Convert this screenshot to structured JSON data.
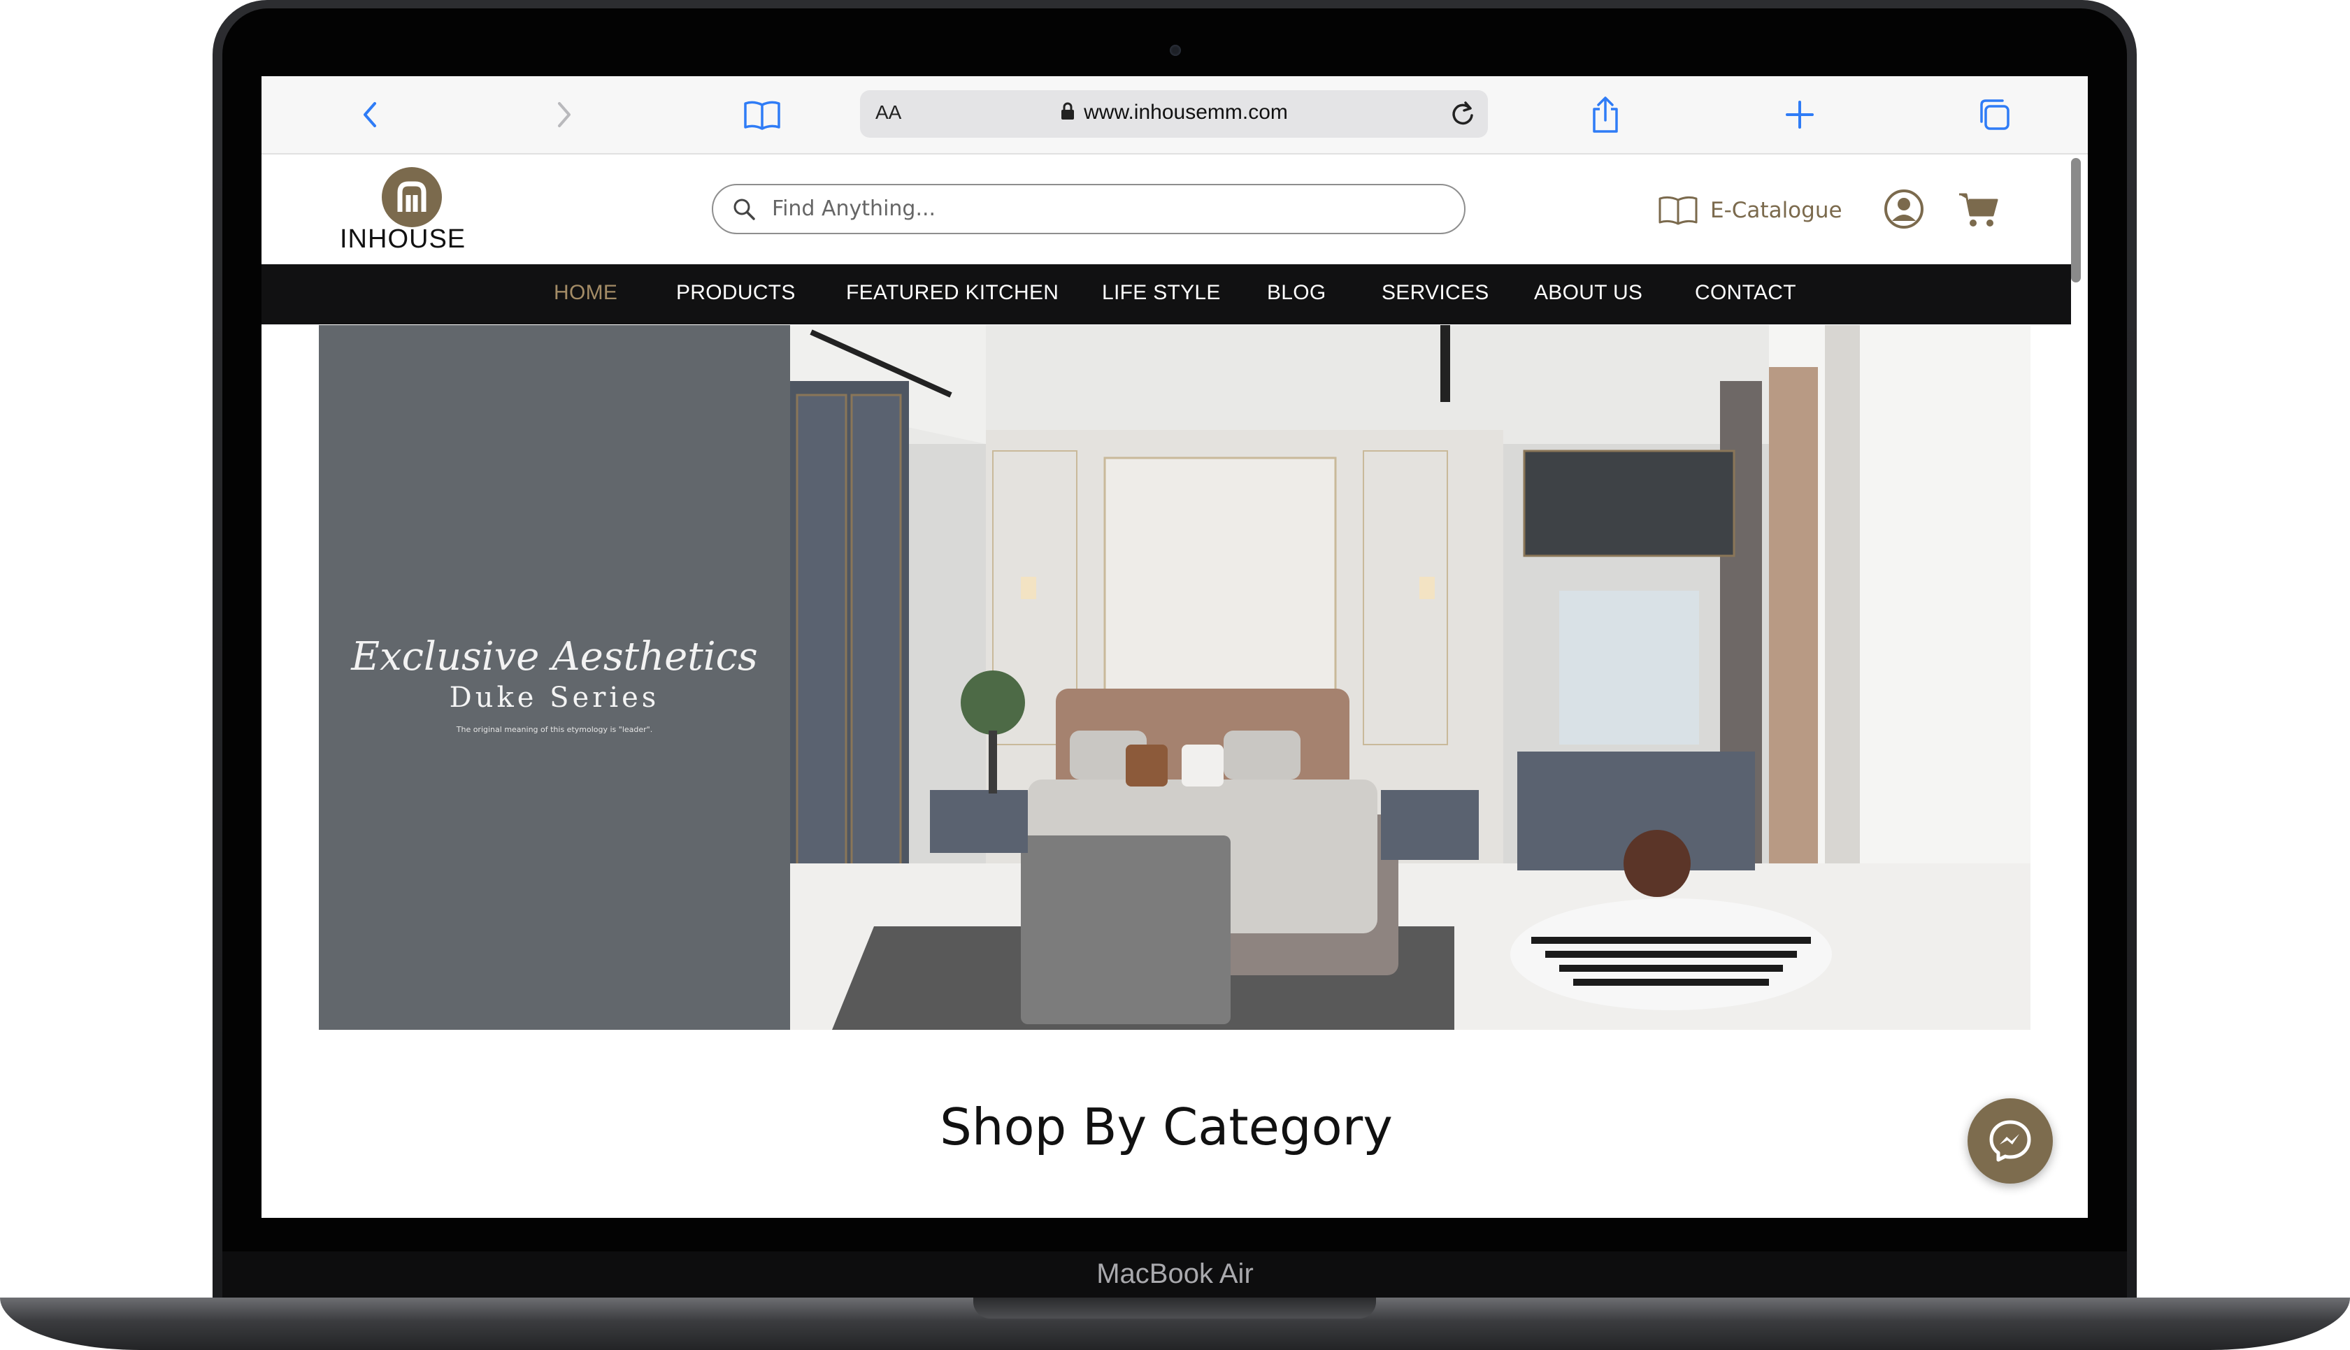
{
  "device": {
    "model_label": "MacBook Air"
  },
  "browser": {
    "reader_label": "AA",
    "url": "www.inhousemm.com"
  },
  "site": {
    "logo_text": "INHOUSE",
    "search": {
      "placeholder": "Find Anything..."
    },
    "header_actions": {
      "catalogue_label": "E-Catalogue"
    },
    "nav": [
      {
        "label": "HOME",
        "active": true
      },
      {
        "label": "PRODUCTS"
      },
      {
        "label": "FEATURED KITCHEN"
      },
      {
        "label": "LIFE STYLE"
      },
      {
        "label": "BLOG"
      },
      {
        "label": "SERVICES"
      },
      {
        "label": "ABOUT US"
      },
      {
        "label": "CONTACT"
      }
    ],
    "hero": {
      "script_line": "Exclusive Aesthetics",
      "title": "Duke Series",
      "caption": "The original meaning of this etymology is \"leader\"."
    },
    "section_title": "Shop By Category"
  },
  "colors": {
    "brand_gold": "#7b6a4d",
    "nav_active": "#a48c66",
    "nav_bg": "#111112",
    "hero_panel": "#62676c",
    "safari_blue": "#2f7cf6"
  },
  "icons": [
    "back-icon",
    "forward-icon",
    "bookmarks-icon",
    "lock-icon",
    "reload-icon",
    "share-icon",
    "new-tab-icon",
    "tabs-icon",
    "search-icon",
    "book-icon",
    "account-icon",
    "cart-icon",
    "messenger-icon"
  ]
}
